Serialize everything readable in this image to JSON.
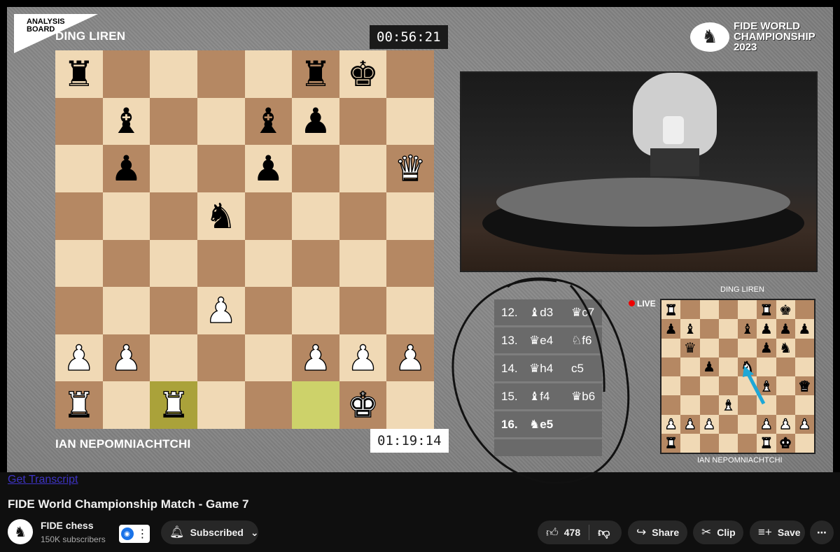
{
  "video": {
    "badge_line1": "ANALYSIS",
    "badge_line2": "BOARD",
    "top_player": "DING LIREN",
    "bottom_player": "IAN NEPOMNIACHTCHI",
    "top_clock": "00:56:21",
    "bottom_clock": "01:19:14",
    "event_logo_line1": "FIDE WORLD",
    "event_logo_line2": "CHAMPIONSHIP",
    "event_logo_line3": "2023",
    "board": [
      [
        "bR",
        "",
        "",
        "",
        "",
        "bR",
        "bK",
        ""
      ],
      [
        "",
        "bB",
        "",
        "",
        "bB",
        "bP",
        "",
        ""
      ],
      [
        "",
        "bP",
        "",
        "",
        "bP",
        "",
        "",
        "wQ"
      ],
      [
        "",
        "",
        "",
        "bN",
        "",
        "",
        "",
        ""
      ],
      [
        "",
        "",
        "",
        "",
        "",
        "",
        "",
        ""
      ],
      [
        "",
        "",
        "",
        "wP",
        "",
        "",
        "",
        ""
      ],
      [
        "wP",
        "wP",
        "",
        "",
        "",
        "wP",
        "wP",
        "wP"
      ],
      [
        "wR",
        "",
        "wR",
        "",
        "",
        "",
        "wK",
        ""
      ]
    ],
    "highlighted_squares": [
      "c1",
      "f1"
    ],
    "moves": [
      {
        "num": "12.",
        "white": "♝d3",
        "black": "♛c7"
      },
      {
        "num": "13.",
        "white": "♛e4",
        "black": "♘f6"
      },
      {
        "num": "14.",
        "white": "♛h4",
        "black": "c5"
      },
      {
        "num": "15.",
        "white": "♝f4",
        "black": "♛b6"
      },
      {
        "num": "16.",
        "white": "♞e5",
        "black": ""
      }
    ],
    "live_label": "LIVE",
    "mini_top_player": "DING LIREN",
    "mini_bottom_player": "IAN NEPOMNIACHTCHI",
    "mini_board": [
      [
        "wR",
        "",
        "",
        "",
        "",
        "wR",
        "bK",
        ""
      ],
      [
        "bP",
        "bB",
        "",
        "",
        "bB",
        "bP",
        "bP",
        "bP"
      ],
      [
        "",
        "bQ",
        "",
        "",
        "",
        "bP",
        "bN",
        ""
      ],
      [
        "",
        "",
        "bP",
        "",
        "wN",
        "",
        "",
        ""
      ],
      [
        "",
        "",
        "",
        "",
        "",
        "wB",
        "",
        "wQ"
      ],
      [
        "",
        "",
        "",
        "wB",
        "",
        "",
        "",
        ""
      ],
      [
        "wP",
        "wP",
        "wP",
        "",
        "",
        "wP",
        "wP",
        "wP"
      ],
      [
        "wR",
        "",
        "",
        "",
        "",
        "wR",
        "wK",
        ""
      ]
    ]
  },
  "below": {
    "transcript_link": "Get Transcript",
    "video_title": "FIDE World Championship Match - Game 7",
    "channel_name": "FIDE chess",
    "subscriber_count": "150K subscribers",
    "subscribed_label": "Subscribed",
    "like_count": "478",
    "share_label": "Share",
    "clip_label": "Clip",
    "save_label": "Save"
  },
  "icons": {
    "bell": "bell-icon",
    "like": "thumbs-up-icon",
    "dislike": "thumbs-down-icon",
    "share": "share-arrow-icon",
    "clip": "scissors-icon",
    "save": "playlist-add-icon",
    "more": "more-horizontal-icon"
  }
}
